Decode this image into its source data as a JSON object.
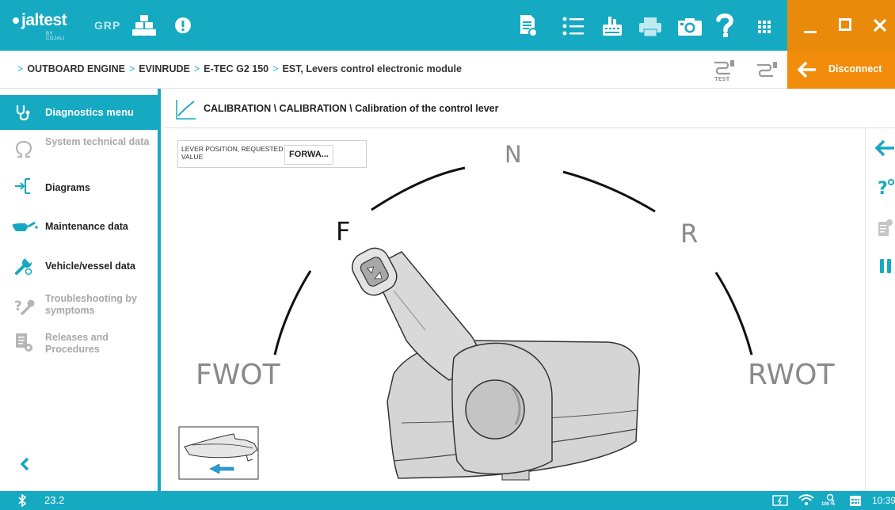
{
  "app": {
    "logo_main": "jaltest",
    "logo_sub": "BY COJALI",
    "grp_label": "GRP",
    "top_icons": [
      "modules-icon",
      "warning-icon",
      "report-icon",
      "list-icon",
      "vci-icon",
      "printer-icon",
      "camera-icon",
      "help-icon",
      "apps-grid-icon"
    ],
    "window_controls": [
      "minimize-icon",
      "maximize-icon",
      "close-icon"
    ]
  },
  "breadcrumb": {
    "items": [
      "OUTBOARD ENGINE",
      "EVINRUDE",
      "E-TEC G2 150",
      "EST, Levers control electronic module"
    ],
    "disconnect_label": "Disconnect"
  },
  "sidebar": {
    "header": "Diagnostics menu",
    "items": [
      {
        "label": "System technical data",
        "icon": "omega-icon",
        "enabled": false
      },
      {
        "label": "Diagrams",
        "icon": "diagram-icon",
        "enabled": true
      },
      {
        "label": "Maintenance data",
        "icon": "oil-can-icon",
        "enabled": true
      },
      {
        "label": "Vehicle/vessel data",
        "icon": "wrench-icon",
        "enabled": true
      },
      {
        "label": "Troubleshooting by symptoms",
        "icon": "troubleshoot-icon",
        "enabled": false
      },
      {
        "label": "Releases and Procedures",
        "icon": "procedures-icon",
        "enabled": false
      }
    ]
  },
  "content": {
    "title": "CALIBRATION \\ CALIBRATION \\ Calibration of the control lever",
    "parameter": {
      "label": "LEVER POSITION, REQUESTED VALUE",
      "value": "FORWA..."
    },
    "lever_positions": {
      "neutral": "N",
      "forward": "F",
      "reverse": "R",
      "forward_wot": "FWOT",
      "reverse_wot": "RWOT"
    }
  },
  "right_toolbar": [
    "back-arrow-icon",
    "help-question-icon",
    "document-icon",
    "pause-icon"
  ],
  "statusbar": {
    "version": "23.2",
    "clock": "10:39",
    "zoom_label": "100 %"
  },
  "colors": {
    "accent": "#16a9c2",
    "orange": "#f28c0a",
    "dark_orange": "#e98a0a"
  }
}
